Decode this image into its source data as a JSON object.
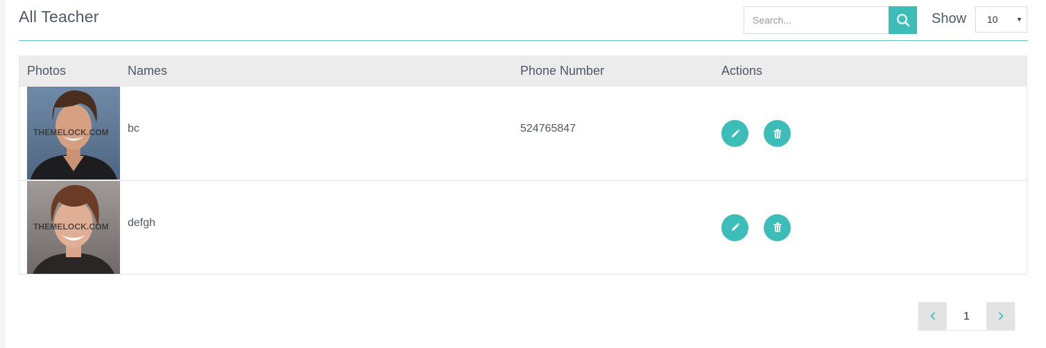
{
  "header": {
    "title": "All Teacher",
    "search_placeholder": "Search...",
    "show_label": "Show",
    "show_value": "10"
  },
  "table": {
    "columns": [
      "Photos",
      "Names",
      "Phone Number",
      "Actions"
    ],
    "rows": [
      {
        "name": "bc",
        "phone": "524765847",
        "photo_watermark": "THEMELOCK.COM"
      },
      {
        "name": "defgh",
        "phone": "",
        "photo_watermark": "THEMELOCK.COM"
      }
    ]
  },
  "pagination": {
    "current_page": "1"
  },
  "icons": {
    "search": "search-icon",
    "edit": "pencil-icon",
    "delete": "trash-icon",
    "prev": "chevron-left-icon",
    "next": "chevron-right-icon",
    "dropdown": "caret-down-icon"
  },
  "colors": {
    "accent": "#3dbdb8",
    "header_row": "#ececec",
    "rule": "#5fc4bf"
  }
}
